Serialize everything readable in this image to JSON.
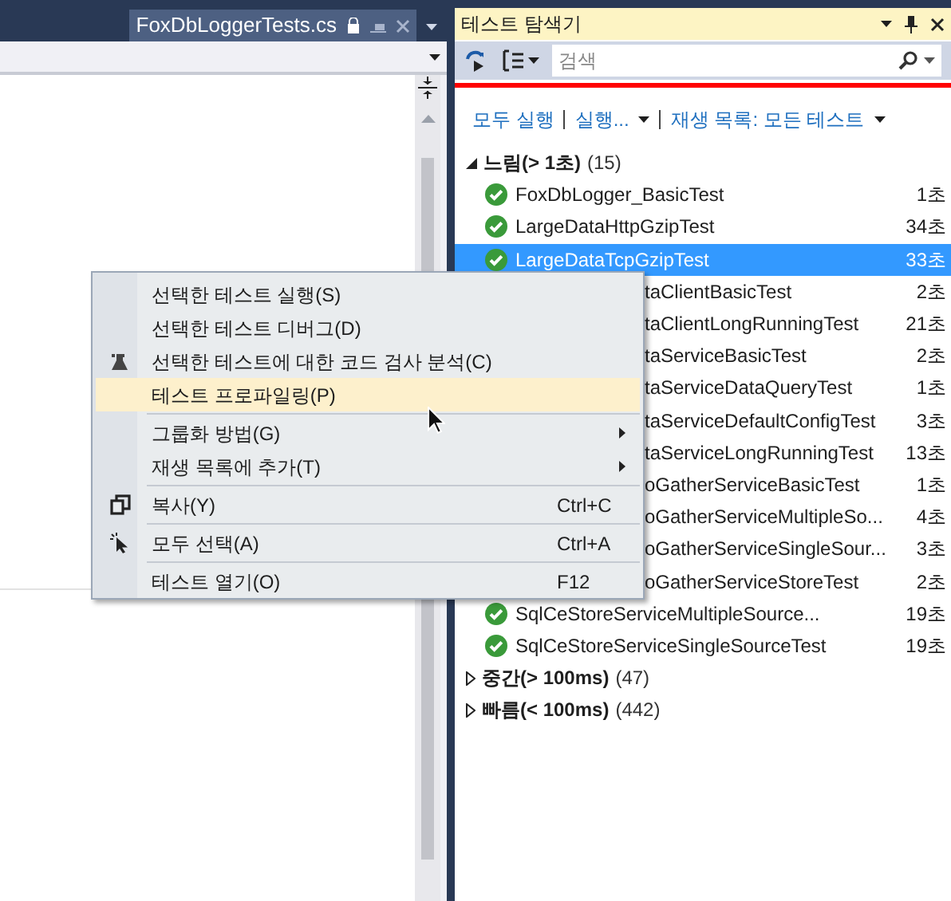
{
  "editor": {
    "tab": {
      "title": "FoxDbLoggerTests.cs",
      "selected": true
    }
  },
  "explorer": {
    "title": "테스트 탐색기",
    "search": {
      "placeholder": "검색"
    },
    "links": [
      "모두 실행",
      "실행...",
      "재생 목록: 모든 테스트"
    ],
    "groups": [
      {
        "label": "느림",
        "range": "(> 1초)",
        "count": "(15)",
        "expanded": true,
        "tests": [
          {
            "kind": "full",
            "name": "FoxDbLogger_BasicTest",
            "time": "1초",
            "selected": false
          },
          {
            "kind": "full",
            "name": "LargeDataHttpGzipTest",
            "time": "34초",
            "selected": false
          },
          {
            "kind": "full",
            "name": "LargeDataTcpGzipTest",
            "time": "33초",
            "selected": true
          },
          {
            "kind": "partial",
            "name": "taClientBasicTest",
            "time": "2초",
            "selected": false
          },
          {
            "kind": "partial",
            "name": "taClientLongRunningTest",
            "time": "21초",
            "selected": false
          },
          {
            "kind": "partial",
            "name": "taServiceBasicTest",
            "time": "2초",
            "selected": false
          },
          {
            "kind": "partial",
            "name": "taServiceDataQueryTest",
            "time": "1초",
            "selected": false
          },
          {
            "kind": "partial",
            "name": "taServiceDefaultConfigTest",
            "time": "3초",
            "selected": false
          },
          {
            "kind": "partial",
            "name": "taServiceLongRunningTest",
            "time": "13초",
            "selected": false
          },
          {
            "kind": "partial",
            "name": "oGatherServiceBasicTest",
            "time": "1초",
            "selected": false
          },
          {
            "kind": "partial",
            "name": "oGatherServiceMultipleSo...",
            "time": "4초",
            "selected": false
          },
          {
            "kind": "partial",
            "name": "oGatherServiceSingleSour...",
            "time": "3초",
            "selected": false
          },
          {
            "kind": "partial",
            "name": "oGatherServiceStoreTest",
            "time": "2초",
            "selected": false
          },
          {
            "kind": "full",
            "name": "SqlCeStoreServiceMultipleSource...",
            "time": "19초",
            "selected": false
          },
          {
            "kind": "full",
            "name": "SqlCeStoreServiceSingleSourceTest",
            "time": "19초",
            "selected": false
          }
        ]
      },
      {
        "label": "중간",
        "range": "(> 100ms)",
        "count": "(47)",
        "expanded": false
      },
      {
        "label": "빠름",
        "range": "(< 100ms)",
        "count": "(442)",
        "expanded": false
      }
    ]
  },
  "context_menu": [
    {
      "kind": "plain",
      "label": "선택한 테스트 실행(S)",
      "selected": false,
      "submenu": false,
      "separator_before": false
    },
    {
      "kind": "plain",
      "label": "선택한 테스트 디버그(D)",
      "selected": false,
      "submenu": false,
      "separator_before": false
    },
    {
      "kind": "coverage",
      "label": "선택한 테스트에 대한 코드 검사 분석(C)",
      "selected": false,
      "submenu": false,
      "separator_before": false
    },
    {
      "kind": "plain",
      "label": "테스트 프로파일링(P)",
      "selected": true,
      "submenu": false,
      "separator_before": false
    },
    {
      "kind": "plain",
      "label": "그룹화 방법(G)",
      "selected": false,
      "submenu": true,
      "separator_before": true
    },
    {
      "kind": "plain",
      "label": "재생 목록에 추가(T)",
      "selected": false,
      "submenu": true,
      "separator_before": false
    },
    {
      "kind": "copy",
      "label": "복사(Y)",
      "shortcut": "Ctrl+C",
      "selected": false,
      "submenu": false,
      "separator_before": true
    },
    {
      "kind": "select",
      "label": "모두 선택(A)",
      "shortcut": "Ctrl+A",
      "selected": false,
      "submenu": false,
      "separator_before": true
    },
    {
      "kind": "plain",
      "label": "테스트 열기(O)",
      "shortcut": "F12",
      "selected": false,
      "submenu": false,
      "separator_before": true
    }
  ]
}
